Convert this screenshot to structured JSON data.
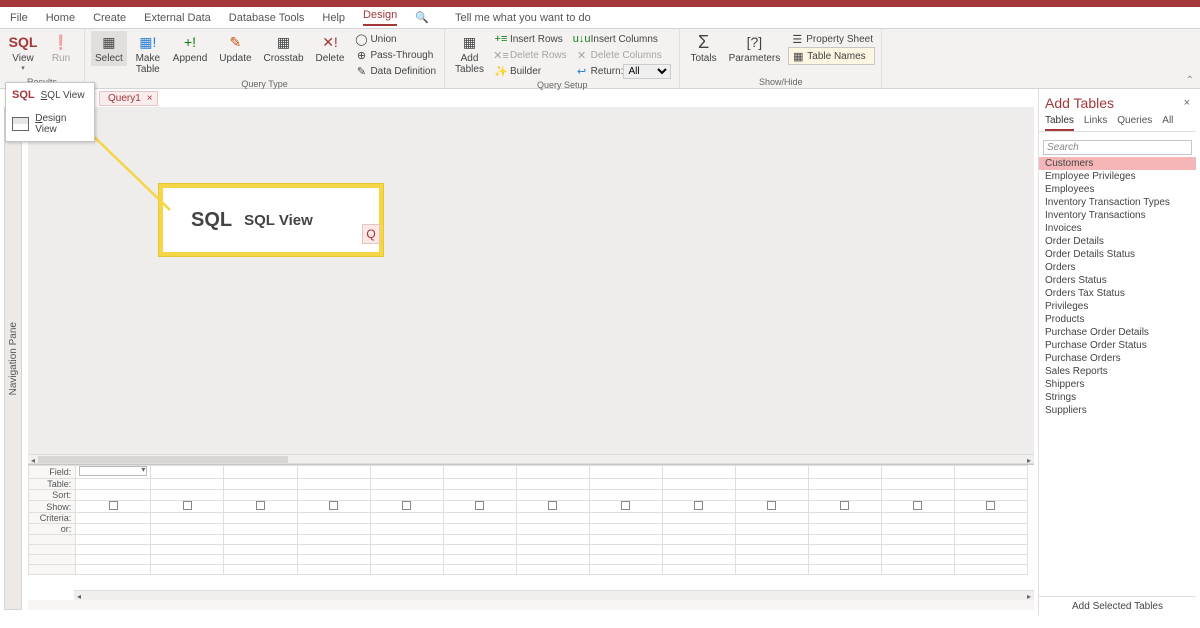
{
  "tabs": {
    "file": "File",
    "home": "Home",
    "create": "Create",
    "external": "External Data",
    "dbtools": "Database Tools",
    "help": "Help",
    "design": "Design",
    "tellme": "Tell me what you want to do"
  },
  "ribbon": {
    "view": "View",
    "run": "Run",
    "sql": "SQL",
    "select": "Select",
    "make": "Make\nTable",
    "append": "Append",
    "update": "Update",
    "crosstab": "Crosstab",
    "delete": "Delete",
    "union": "Union",
    "passthrough": "Pass-Through",
    "datadef": "Data Definition",
    "addtables": "Add\nTables",
    "insrows": "Insert Rows",
    "delrows": "Delete Rows",
    "builder": "Builder",
    "inscols": "Insert Columns",
    "delcols": "Delete Columns",
    "return": "Return:",
    "return_val": "All",
    "totals": "Totals",
    "params": "Parameters",
    "propsheet": "Property Sheet",
    "tablenames": "Table Names",
    "g_results": "Results",
    "g_qtype": "Query Type",
    "g_setup": "Query Setup",
    "g_showhide": "Show/Hide"
  },
  "viewmenu": {
    "sql": "SQL View",
    "design": "Design View",
    "sql_prefix": "SQL"
  },
  "doctab": {
    "name": "Query1"
  },
  "navpane": "Navigation Pane",
  "grid": {
    "field": "Field:",
    "table": "Table:",
    "sort": "Sort:",
    "show": "Show:",
    "criteria": "Criteria:",
    "or": "or:"
  },
  "addtables": {
    "title": "Add Tables",
    "tabs": {
      "tables": "Tables",
      "links": "Links",
      "queries": "Queries",
      "all": "All"
    },
    "search": "Search",
    "items": [
      "Customers",
      "Employee Privileges",
      "Employees",
      "Inventory Transaction Types",
      "Inventory Transactions",
      "Invoices",
      "Order Details",
      "Order Details Status",
      "Orders",
      "Orders Status",
      "Orders Tax Status",
      "Privileges",
      "Products",
      "Purchase Order Details",
      "Purchase Order Status",
      "Purchase Orders",
      "Sales Reports",
      "Shippers",
      "Strings",
      "Suppliers"
    ],
    "selected": "Customers",
    "button": "Add Selected Tables"
  },
  "callout": {
    "big": "SQL",
    "label": "SQL View",
    "q": "Q"
  }
}
